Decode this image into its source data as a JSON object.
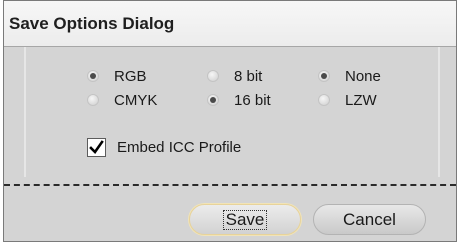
{
  "dialog": {
    "title": "Save Options Dialog"
  },
  "color_mode": {
    "options": [
      {
        "label": "RGB",
        "selected": true
      },
      {
        "label": "CMYK",
        "selected": false
      }
    ]
  },
  "bit_depth": {
    "options": [
      {
        "label": "8 bit",
        "selected": false
      },
      {
        "label": "16 bit",
        "selected": true
      }
    ]
  },
  "compression": {
    "options": [
      {
        "label": "None",
        "selected": true
      },
      {
        "label": "LZW",
        "selected": false
      }
    ]
  },
  "embed_icc": {
    "label": "Embed ICC Profile",
    "checked": true
  },
  "buttons": {
    "save_label": "Save",
    "cancel_label": "Cancel"
  },
  "icons": {
    "checkmark": "✔"
  },
  "colors": {
    "dialog_background": "#d4d4d4",
    "titlebar_background": "#f2f2f2",
    "save_button_focus": "#e8d39a"
  }
}
